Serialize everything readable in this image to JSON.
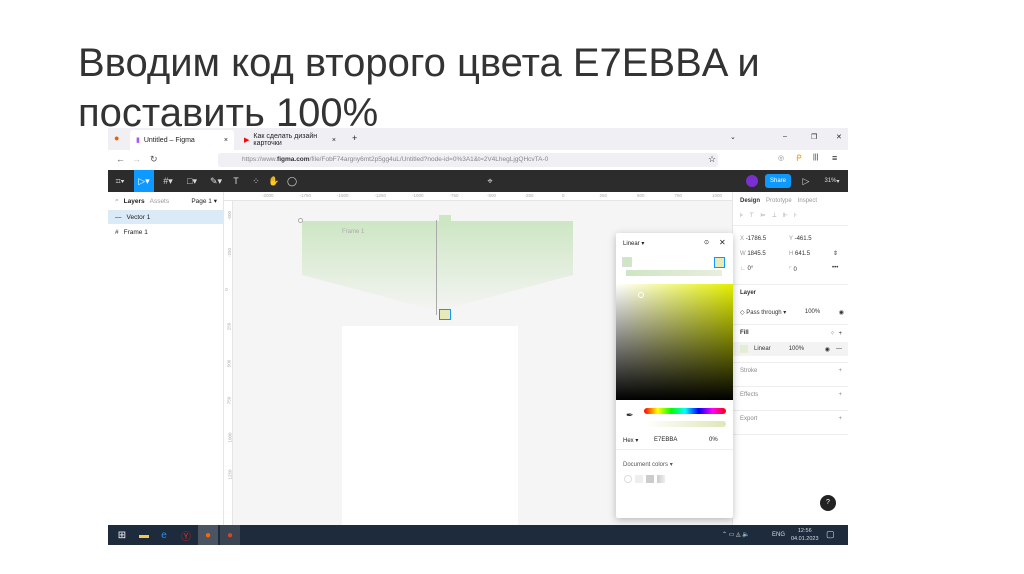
{
  "slide": {
    "title_line1": "Вводим код второго цвета E7EBBA и",
    "title_line2": "поставить 100%"
  },
  "browser": {
    "tabs": [
      {
        "label": "Untitled – Figma"
      },
      {
        "label": "Как сделать дизайн карточки"
      }
    ],
    "url_prefix": "https://www.",
    "url_domain": "figma.com",
    "url_rest": "/file/FobF74argny6mt2p5gg4uL/Untitled?node-id=0%3A1&t=2V4LhegLjgQHcvTA-0"
  },
  "figma": {
    "share_label": "Share",
    "zoom": "31%",
    "left_panel": {
      "tab_layers": "Layers",
      "tab_assets": "Assets",
      "page": "Page 1",
      "layers": [
        {
          "name": "Vector 1"
        },
        {
          "name": "Frame 1"
        }
      ]
    },
    "canvas": {
      "frame_label": "Frame 1",
      "ruler_h": [
        "-2000",
        "-1750",
        "-1500",
        "-1250",
        "-1000",
        "-750",
        "-500",
        "-250",
        "0",
        "250",
        "500",
        "750",
        "1000"
      ],
      "ruler_v": [
        "-500",
        "-250",
        "0",
        "250",
        "500",
        "750",
        "1000",
        "1250"
      ]
    },
    "right_panel": {
      "tabs": [
        "Design",
        "Prototype",
        "Inspect"
      ],
      "x_label": "X",
      "x": "-1786.5",
      "y_label": "Y",
      "y": "-461.5",
      "w_label": "W",
      "w": "1845.5",
      "h_label": "H",
      "h": "641.5",
      "rotation": "0°",
      "radius": "0",
      "layer_title": "Layer",
      "blend": "Pass through",
      "layer_opacity": "100%",
      "fill_title": "Fill",
      "fill_type": "Linear",
      "fill_opacity": "100%",
      "stroke": "Stroke",
      "effects": "Effects",
      "export": "Export"
    },
    "picker": {
      "type": "Linear",
      "hex_label": "Hex",
      "hex": "E7EBBA",
      "opacity": "0%",
      "doc_colors": "Document colors"
    }
  },
  "taskbar": {
    "lang": "ENG",
    "time": "12:56",
    "date": "04.01.2023"
  },
  "colors": {
    "stop_color": "#E7EBBA",
    "accent": "#0d99ff"
  }
}
